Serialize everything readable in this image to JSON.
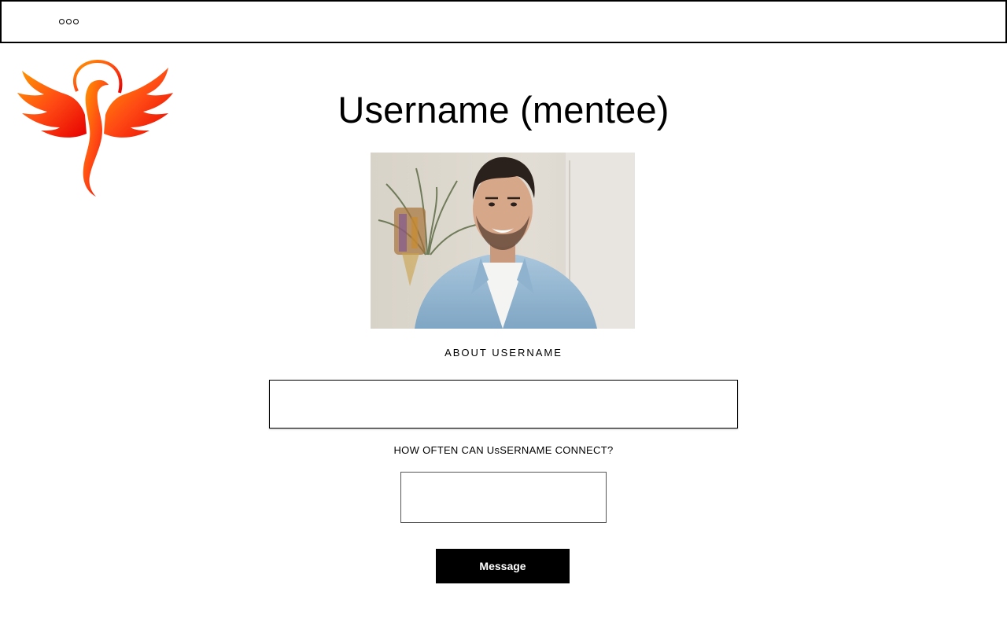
{
  "header": {
    "menu_icon": "more-dots-icon"
  },
  "logo": {
    "icon": "phoenix-logo",
    "colors": [
      "#ff8a00",
      "#ff3d1f",
      "#e60000"
    ]
  },
  "profile": {
    "title": "Username (mentee)",
    "photo_alt": "profile photo",
    "about_label": "ABOUT USERNAME",
    "about_value": "",
    "connect_label": "HOW OFTEN CAN UsSERNAME CONNECT?",
    "connect_value": "",
    "message_button": "Message"
  }
}
